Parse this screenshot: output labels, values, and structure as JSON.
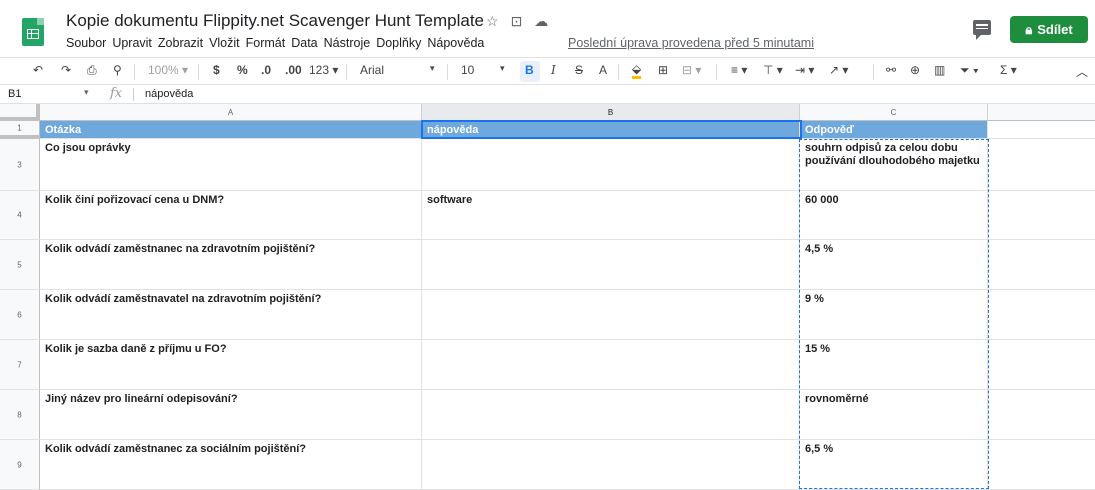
{
  "header": {
    "title": "Kopie dokumentu Flippity.net Scavenger Hunt Template",
    "title_icons": [
      "star-icon",
      "move-to-folder-icon",
      "cloud-status-icon"
    ],
    "menu": [
      "Soubor",
      "Upravit",
      "Zobrazit",
      "Vložit",
      "Formát",
      "Data",
      "Nástroje",
      "Doplňky",
      "Nápověda"
    ],
    "last_edit": "Poslední úprava provedena před 5 minutami",
    "share_label": "Sdílet",
    "share_color": "#1e8e3e",
    "logo_color": "#23a566"
  },
  "toolbar": {
    "zoom": "100%",
    "currency": "$",
    "percent": "%",
    "decimal_decrease": ".0",
    "decimal_increase": ".00",
    "format_more": "123",
    "font": "Arial",
    "font_size": "10",
    "bold": "B",
    "italic": "I",
    "strike": "S",
    "text_color": "A",
    "sigma": "Σ"
  },
  "formula_bar": {
    "name_box": "B1",
    "fx": "fx",
    "value": "nápověda"
  },
  "grid": {
    "columns": [
      "A",
      "B",
      "C"
    ],
    "header_fill": "#6fa8dc",
    "selection_color": "#1a73e8",
    "active_cell": "B1",
    "rows": [
      {
        "num": "1",
        "a": "Otázka",
        "b": "nápověda",
        "c": "Odpověď"
      },
      {
        "num": "3",
        "a": "Co jsou oprávky",
        "b": "",
        "c": "souhrn odpisů za celou dobu používání dlouhodobého majetku"
      },
      {
        "num": "4",
        "a": "Kolik činí pořizovací cena u DNM?",
        "b": "software",
        "c": "60 000"
      },
      {
        "num": "5",
        "a": "Kolik odvádí zaměstnanec na zdravotním pojištění?",
        "b": "",
        "c": "4,5 %"
      },
      {
        "num": "6",
        "a": "Kolik odvádí zaměstnavatel na zdravotním pojištění?",
        "b": "",
        "c": "9 %"
      },
      {
        "num": "7",
        "a": "Kolik je sazba daně z příjmu u FO?",
        "b": "",
        "c": "15 %"
      },
      {
        "num": "8",
        "a": "Jiný název pro lineární odepisování?",
        "b": "",
        "c": "rovnoměrné"
      },
      {
        "num": "9",
        "a": "Kolik odvádí zaměstnanec za sociálním pojištění?",
        "b": "",
        "c": "6,5 %"
      }
    ]
  }
}
